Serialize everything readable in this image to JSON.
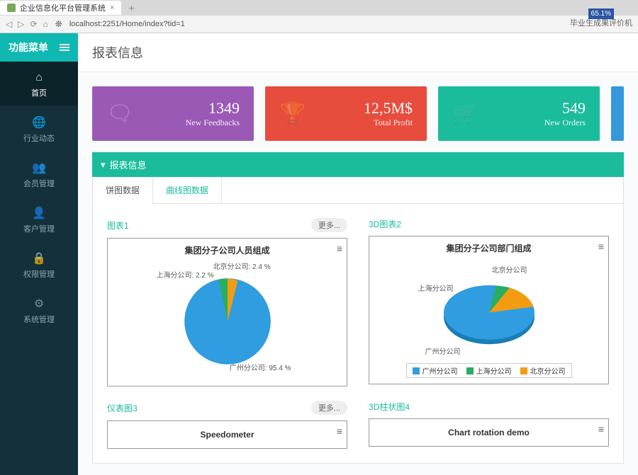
{
  "browser": {
    "tab_title": "企业信息化平台管理系统",
    "address": "localhost:2251/Home/index?tid=1",
    "progress": "65.1%",
    "top_right_link": "毕业生成果评价机"
  },
  "sidebar": {
    "title": "功能菜单",
    "items": [
      {
        "label": "首页",
        "icon": "home"
      },
      {
        "label": "行业动态",
        "icon": "globe"
      },
      {
        "label": "会员管理",
        "icon": "users"
      },
      {
        "label": "客户管理",
        "icon": "user"
      },
      {
        "label": "权限管理",
        "icon": "lock"
      },
      {
        "label": "系统管理",
        "icon": "gear"
      }
    ]
  },
  "page_title": "报表信息",
  "kpi": [
    {
      "value": "1349",
      "label": "New Feedbacks",
      "icon": "chat",
      "color": "purple"
    },
    {
      "value": "12,5M$",
      "label": "Total Profit",
      "icon": "trophy",
      "color": "red"
    },
    {
      "value": "549",
      "label": "New Orders",
      "icon": "cart",
      "color": "teal"
    }
  ],
  "panel": {
    "title": "报表信息",
    "tabs": [
      "饼图数据",
      "曲线图数据"
    ]
  },
  "charts": {
    "row1": [
      {
        "title": "图表1",
        "more": "更多...",
        "inner_title": "集团分子公司人员组成"
      },
      {
        "title": "3D图表2",
        "inner_title": "集团分子公司部门组成"
      }
    ],
    "row2": [
      {
        "title": "仪表图3",
        "more": "更多...",
        "inner_title": "Speedometer"
      },
      {
        "title": "3D柱状图4",
        "inner_title": "Chart rotation demo"
      }
    ]
  },
  "chart_data": [
    {
      "type": "pie",
      "title": "集团分子公司人员组成",
      "series": [
        {
          "name": "广州分公司",
          "value": 95.4
        },
        {
          "name": "上海分公司",
          "value": 2.2
        },
        {
          "name": "北京分公司",
          "value": 2.4
        }
      ]
    },
    {
      "type": "pie",
      "title": "集团分子公司部门组成",
      "series": [
        {
          "name": "广州分公司",
          "value": 80
        },
        {
          "name": "上海分公司",
          "value": 8
        },
        {
          "name": "北京分公司",
          "value": 12
        }
      ],
      "legend": [
        "广州分公司",
        "上海分公司",
        "北京分公司"
      ]
    }
  ]
}
